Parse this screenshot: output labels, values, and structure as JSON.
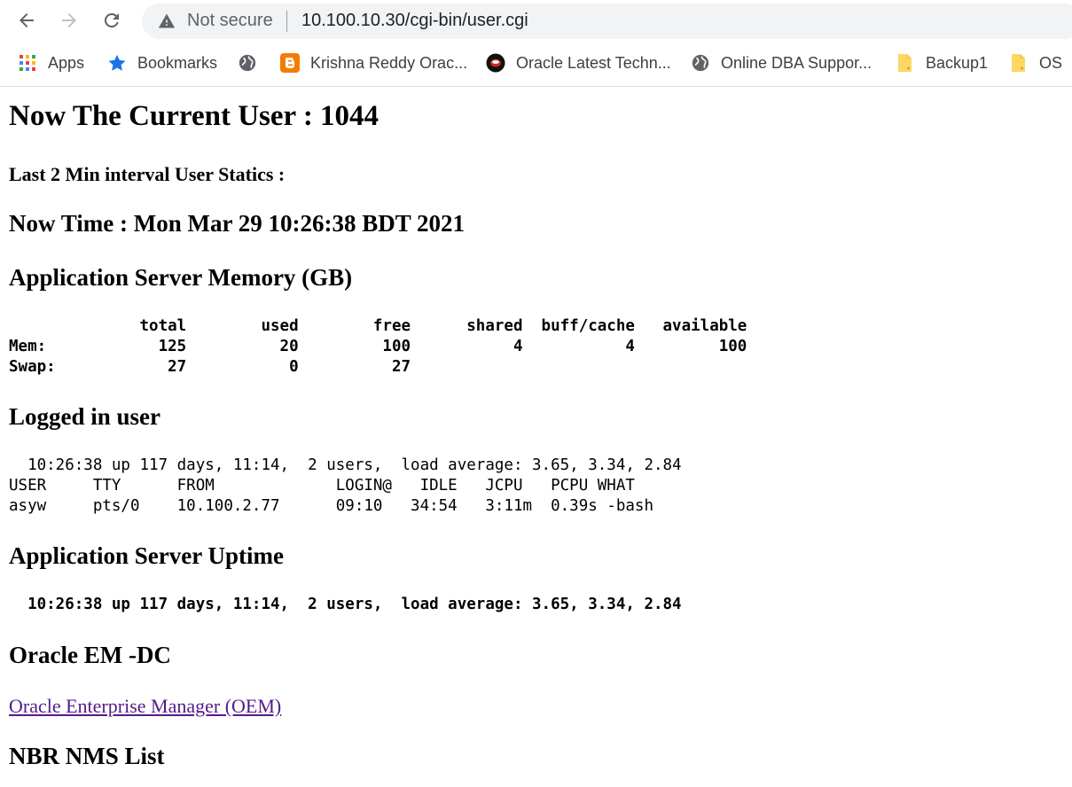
{
  "browser": {
    "security_label": "Not secure",
    "url": "10.100.10.30/cgi-bin/user.cgi",
    "bookmarks": [
      {
        "label": "Apps",
        "icon": "apps-grid-icon"
      },
      {
        "label": "Bookmarks",
        "icon": "star-icon"
      },
      {
        "label": "",
        "icon": "globe-icon"
      },
      {
        "label": "Krishna Reddy Orac...",
        "icon": "blogger-icon"
      },
      {
        "label": "Oracle Latest Techn...",
        "icon": "site-icon"
      },
      {
        "label": "Online DBA Suppor...",
        "icon": "globe-icon"
      },
      {
        "label": "Backup1",
        "icon": "folder-icon"
      },
      {
        "label": "OS",
        "icon": "folder-icon"
      }
    ]
  },
  "page": {
    "current_user": "Now The Current User : 1044",
    "interval_stats": "Last 2 Min interval User Statics :",
    "now_time": "Now Time : Mon Mar 29 10:26:38 BDT 2021",
    "memory_heading": "Application Server Memory (GB)",
    "memory_table": "              total        used        free      shared  buff/cache   available\nMem:            125          20         100           4           4         100\nSwap:            27           0          27",
    "logged_heading": "Logged in user",
    "logged_output": "  10:26:38 up 117 days, 11:14,  2 users,  load average: 3.65, 3.34, 2.84\nUSER     TTY      FROM             LOGIN@   IDLE   JCPU   PCPU WHAT\nasyw     pts/0    10.100.2.77      09:10   34:54   3:11m  0.39s -bash",
    "uptime_heading": "Application Server Uptime",
    "uptime_output": "  10:26:38 up 117 days, 11:14,  2 users,  load average: 3.65, 3.34, 2.84",
    "oem_heading": "Oracle EM -DC",
    "oem_link": "Oracle Enterprise Manager (OEM)",
    "nms_heading": "NBR NMS List"
  },
  "colors": {
    "link_visited": "#551a8b",
    "omnibox_bg": "#f1f3f4"
  }
}
